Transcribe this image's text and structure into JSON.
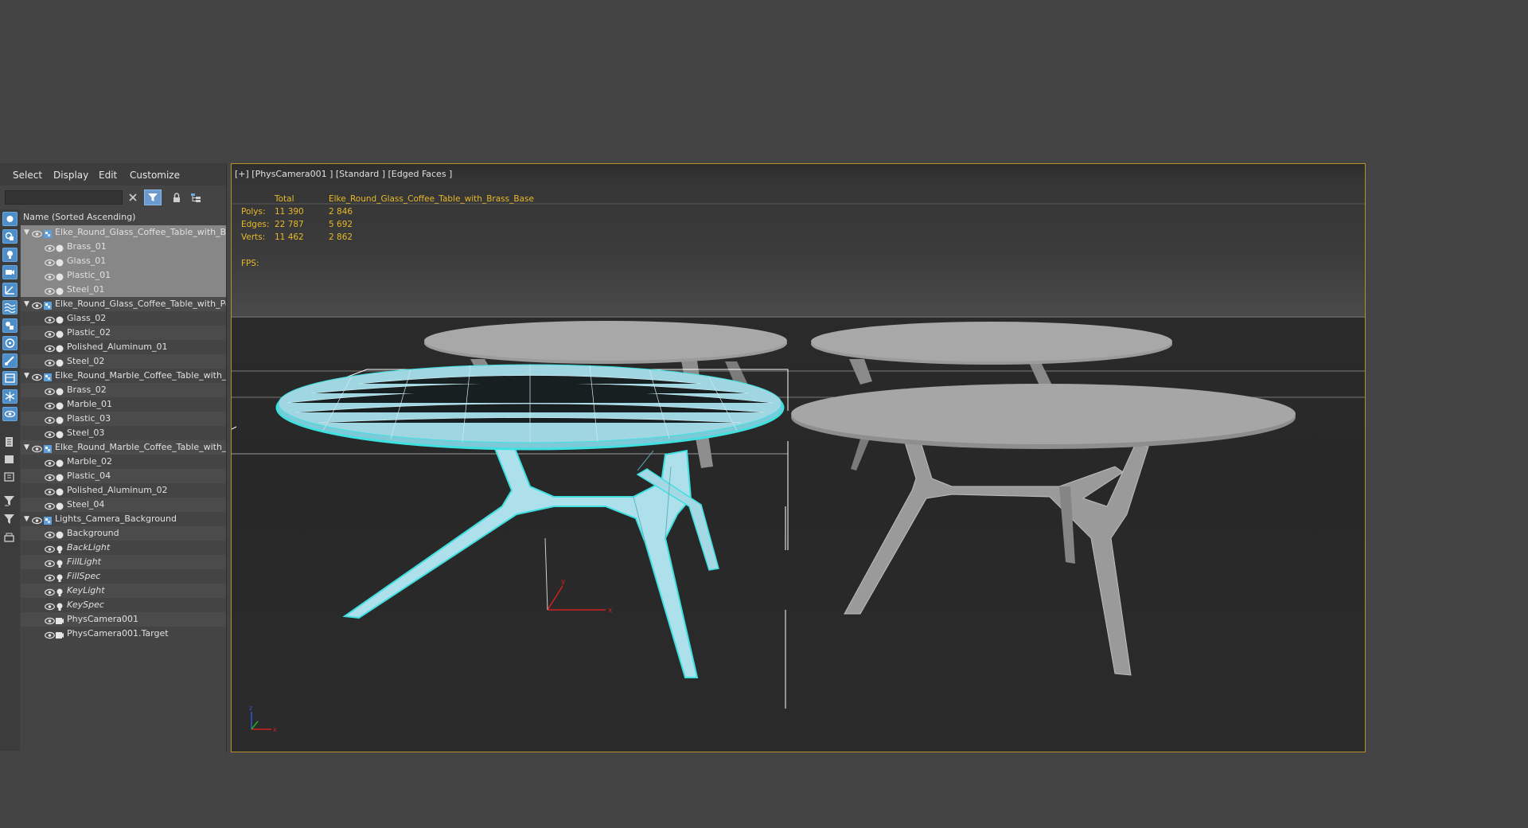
{
  "explorer": {
    "menu": [
      "Select",
      "Display",
      "Edit",
      "Customize"
    ],
    "search_placeholder": "",
    "column_header": "Name (Sorted Ascending)",
    "rows": [
      {
        "label": "Elke_Round_Glass_Coffee_Table_with_Brass_Base",
        "type": "group"
      },
      {
        "label": "Brass_01",
        "type": "material"
      },
      {
        "label": "Glass_01",
        "type": "material"
      },
      {
        "label": "Plastic_01",
        "type": "material"
      },
      {
        "label": "Steel_01",
        "type": "material"
      },
      {
        "label": "Elke_Round_Glass_Coffee_Table_with_Polished_Aluminum_Base",
        "type": "group"
      },
      {
        "label": "Glass_02",
        "type": "material"
      },
      {
        "label": "Plastic_02",
        "type": "material"
      },
      {
        "label": "Polished_Aluminum_01",
        "type": "material"
      },
      {
        "label": "Steel_02",
        "type": "material"
      },
      {
        "label": "Elke_Round_Marble_Coffee_Table_with_Brass_Base",
        "type": "group"
      },
      {
        "label": "Brass_02",
        "type": "material"
      },
      {
        "label": "Marble_01",
        "type": "material"
      },
      {
        "label": "Plastic_03",
        "type": "material"
      },
      {
        "label": "Steel_03",
        "type": "material"
      },
      {
        "label": "Elke_Round_Marble_Coffee_Table_with_Polished_Aluminum_Base",
        "type": "group"
      },
      {
        "label": "Marble_02",
        "type": "material"
      },
      {
        "label": "Plastic_04",
        "type": "material"
      },
      {
        "label": "Polished_Aluminum_02",
        "type": "material"
      },
      {
        "label": "Steel_04",
        "type": "material"
      },
      {
        "label": "Lights_Camera_Background",
        "type": "group"
      },
      {
        "label": "Background",
        "type": "material"
      },
      {
        "label": "BackLight",
        "type": "light"
      },
      {
        "label": "FillLight",
        "type": "light"
      },
      {
        "label": "FillSpec",
        "type": "light"
      },
      {
        "label": "KeyLight",
        "type": "light"
      },
      {
        "label": "KeySpec",
        "type": "light"
      },
      {
        "label": "PhysCamera001",
        "type": "camera"
      },
      {
        "label": "PhysCamera001.Target",
        "type": "camera"
      }
    ]
  },
  "viewport": {
    "label": "[+] [PhysCamera001 ] [Standard ] [Edged Faces ]",
    "stats": {
      "col_total": "Total",
      "col_selected": "Elke_Round_Glass_Coffee_Table_with_Brass_Base",
      "rows": [
        {
          "name": "Polys:",
          "total": "11 390",
          "selected": "2 846"
        },
        {
          "name": "Edges:",
          "total": "22 787",
          "selected": "5 692"
        },
        {
          "name": "Verts:",
          "total": "11 462",
          "selected": "2 862"
        }
      ]
    },
    "fps_label": "FPS:",
    "gizmo_x": "x",
    "gizmo_y": "y",
    "corner_x": "x",
    "corner_z": "z"
  },
  "colors": {
    "selection_cyan": "#3fe0e0",
    "stats_yellow": "#e6b829",
    "viewport_border": "#b8902a"
  }
}
